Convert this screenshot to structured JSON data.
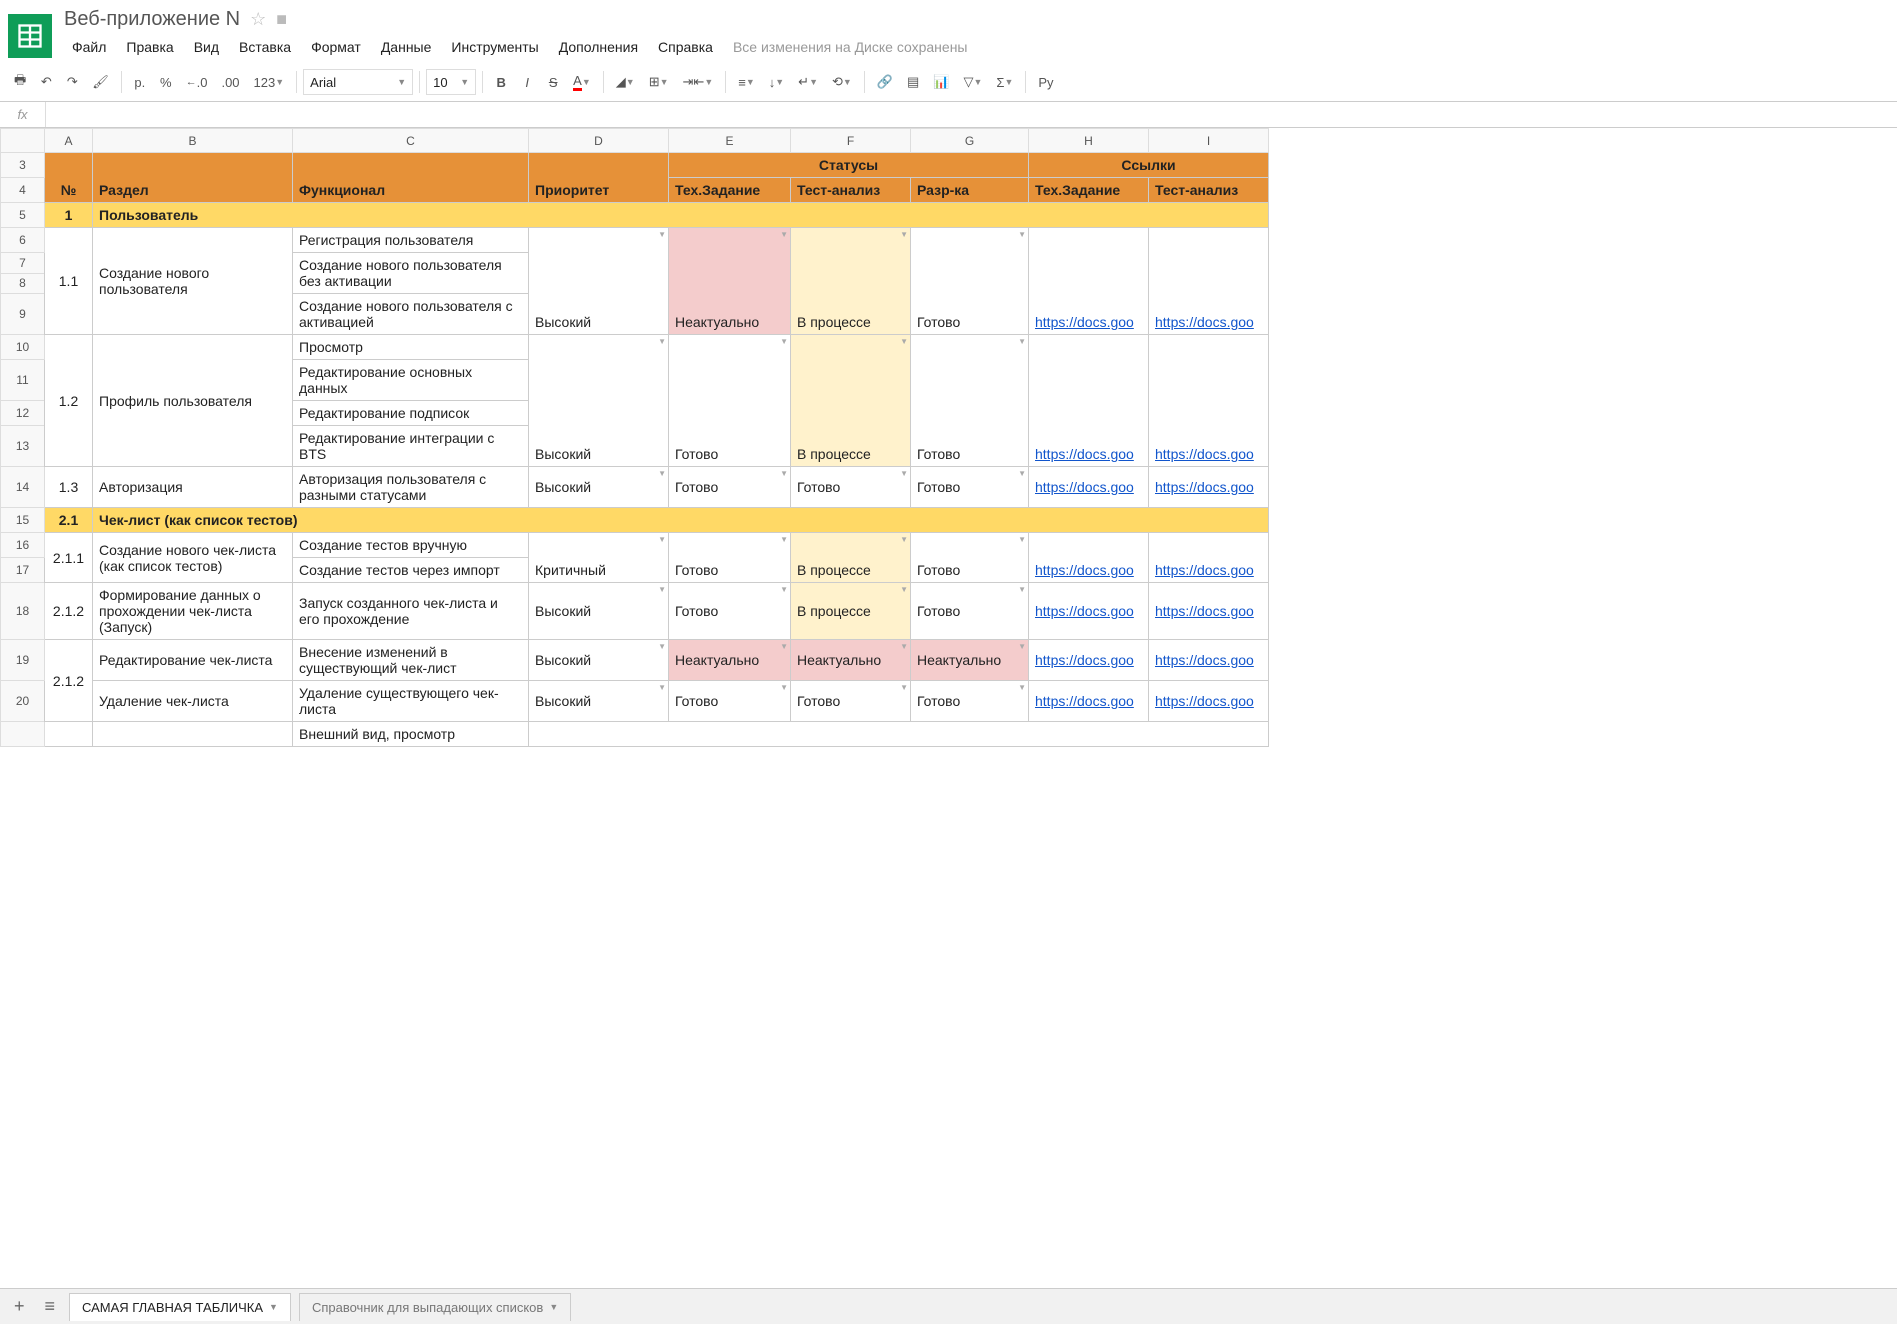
{
  "doc": {
    "title": "Веб-приложение N",
    "save_status": "Все изменения на Диске сохранены"
  },
  "menu": [
    "Файл",
    "Правка",
    "Вид",
    "Вставка",
    "Формат",
    "Данные",
    "Инструменты",
    "Дополнения",
    "Справка"
  ],
  "toolbar": {
    "currency": "р.",
    "percent": "%",
    "dec_dec": ".0",
    "dec_inc": ".00",
    "num_fmt": "123",
    "font": "Arial",
    "size": "10",
    "bold": "B",
    "italic": "I",
    "strike": "S",
    "color": "A",
    "script": "Py"
  },
  "fx": "fx",
  "columns": [
    "A",
    "B",
    "C",
    "D",
    "E",
    "F",
    "G",
    "H",
    "I"
  ],
  "row_numbers": [
    "3",
    "4",
    "5",
    "6",
    "7",
    "8",
    "9",
    "10",
    "11",
    "12",
    "13",
    "14",
    "15",
    "16",
    "17",
    "18",
    "19",
    "20"
  ],
  "header": {
    "statuses": "Статусы",
    "links": "Ссылки",
    "num": "№",
    "section": "Раздел",
    "func": "Функционал",
    "priority": "Приоритет",
    "tz": "Тех.Задание",
    "ta": "Тест-анализ",
    "dev": "Разр-ка",
    "tz2": "Тех.Задание",
    "ta2": "Тест-анализ"
  },
  "sections": {
    "s1": {
      "num": "1",
      "title": "Пользователь"
    },
    "s2": {
      "num": "2.1",
      "title": "Чек-лист (как список тестов)"
    }
  },
  "r": {
    "r11": {
      "num": "1.1",
      "section": "Создание нового пользователя",
      "f1": "Регистрация пользователя",
      "f2": "Создание нового пользователя без активации",
      "f3": "Создание нового пользователя с активацией",
      "priority": "Высокий",
      "tz": "Неактуально",
      "ta": "В процессе",
      "dev": "Готово",
      "l1": "https://docs.goo",
      "l2": "https://docs.goo"
    },
    "r12": {
      "num": "1.2",
      "section": "Профиль пользователя",
      "f1": "Просмотр",
      "f2": "Редактирование основных данных",
      "f3": "Редактирование подписок",
      "f4": "Редактирование интеграции с BTS",
      "priority": "Высокий",
      "tz": "Готово",
      "ta": "В процессе",
      "dev": "Готово",
      "l1": "https://docs.goo",
      "l2": "https://docs.goo"
    },
    "r13": {
      "num": "1.3",
      "section": "Авторизация",
      "f1": "Авторизация пользователя с разными статусами",
      "priority": "Высокий",
      "tz": "Готово",
      "ta": "Готово",
      "dev": "Готово",
      "l1": "https://docs.goo",
      "l2": "https://docs.goo"
    },
    "r211": {
      "num": "2.1.1",
      "section": "Создание нового чек-листа (как список тестов)",
      "f1": "Создание тестов вручную",
      "f2": "Создание тестов через импорт",
      "priority": "Критичный",
      "tz": "Готово",
      "ta": "В процессе",
      "dev": "Готово",
      "l1": "https://docs.goo",
      "l2": "https://docs.goo"
    },
    "r212a": {
      "num": "2.1.2",
      "section": "Формирование данных о прохождении чек-листа (Запуск)",
      "f1": "Запуск созданного чек-листа и его прохождение",
      "priority": "Высокий",
      "tz": "Готово",
      "ta": "В процессе",
      "dev": "Готово",
      "l1": "https://docs.goo",
      "l2": "https://docs.goo"
    },
    "r212b": {
      "num": "2.1.2",
      "s1": "Редактирование чек-листа",
      "f1": "Внесение изменений в существующий чек-лист",
      "priority1": "Высокий",
      "tz1": "Неактуально",
      "ta1": "Неактуально",
      "dev1": "Неактуально",
      "l1a": "https://docs.goo",
      "l1b": "https://docs.goo",
      "s2": "Удаление чек-листа",
      "f2": "Удаление существующего чек-листа",
      "priority2": "Высокий",
      "tz2": "Готово",
      "ta2": "Готово",
      "dev2": "Готово",
      "l2a": "https://docs.goo",
      "l2b": "https://docs.goo"
    },
    "cut": "Внешний вид, просмотр"
  },
  "tabs": {
    "t1": "САМАЯ ГЛАВНАЯ ТАБЛИЧКА",
    "t2": "Справочник для выпадающих списков"
  }
}
